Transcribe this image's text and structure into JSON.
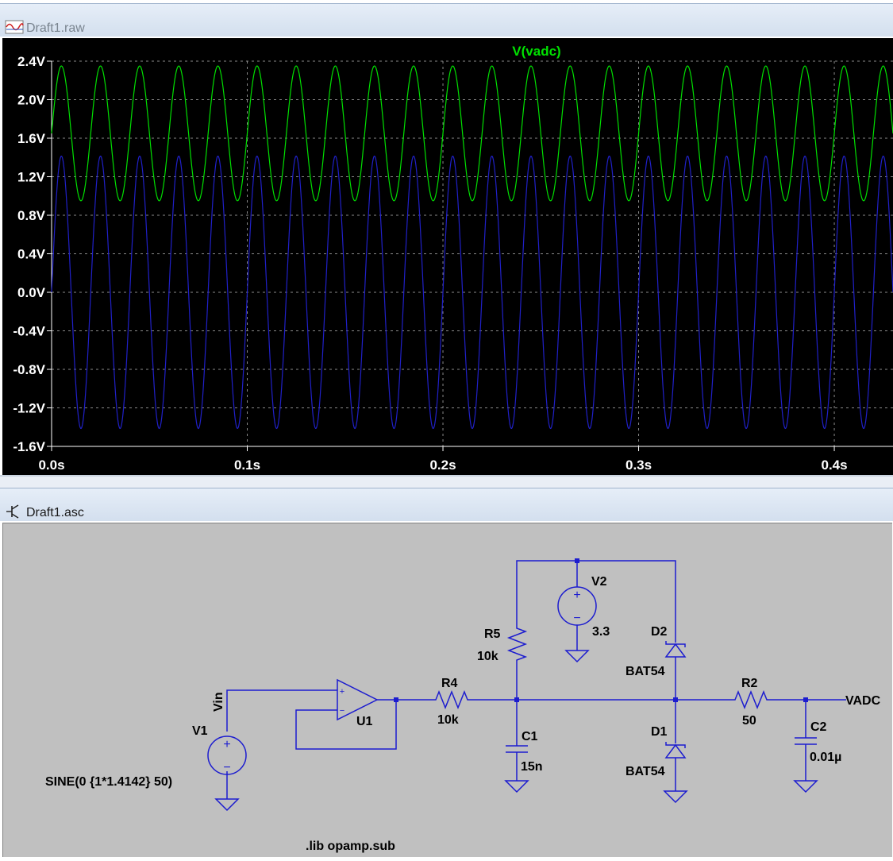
{
  "waveform_window": {
    "title": "Draft1.raw",
    "trace_label": "V(vadc)",
    "y_ticks": [
      "2.4V",
      "2.0V",
      "1.6V",
      "1.2V",
      "0.8V",
      "0.4V",
      "0.0V",
      "-0.4V",
      "-0.8V",
      "-1.2V",
      "-1.6V"
    ],
    "x_ticks": [
      "0.0s",
      "0.1s",
      "0.2s",
      "0.3s",
      "0.4s"
    ],
    "colors": {
      "background": "#000000",
      "trace_vadc": "#00e000",
      "trace_other": "#2020c8",
      "grid": "#8a8a8a",
      "label": "#ffffff"
    }
  },
  "chart_data": {
    "type": "line",
    "title": "V(vadc)",
    "xlabel": "",
    "ylabel": "",
    "xlim": [
      0,
      0.43
    ],
    "ylim": [
      -1.6,
      2.4
    ],
    "x_ticks": [
      0,
      0.1,
      0.2,
      0.3,
      0.4
    ],
    "y_ticks": [
      2.4,
      2.0,
      1.6,
      1.2,
      0.8,
      0.4,
      0.0,
      -0.4,
      -0.8,
      -1.2,
      -1.6
    ],
    "grid": true,
    "series": [
      {
        "name": "V(vadc)",
        "color": "#00e000",
        "waveform": "sine",
        "frequency_hz": 50,
        "offset": 1.65,
        "amplitude": 0.7,
        "phase_deg": 0
      },
      {
        "color": "#2020c8",
        "waveform": "sine",
        "frequency_hz": 50,
        "offset": 0,
        "amplitude": 1.4142,
        "phase_deg": 0
      }
    ]
  },
  "schematic_window": {
    "title": "Draft1.asc",
    "labels": {
      "vin": "Vin",
      "v1": "V1",
      "v1_value": "SINE(0 {1*1.4142} 50)",
      "u1": "U1",
      "r4": "R4",
      "r4_value": "10k",
      "r5": "R5",
      "r5_value": "10k",
      "c1": "C1",
      "c1_value": "15n",
      "v2": "V2",
      "v2_value": "3.3",
      "d2": "D2",
      "d2_value": "BAT54",
      "d1": "D1",
      "d1_value": "BAT54",
      "r2": "R2",
      "r2_value": "50",
      "c2": "C2",
      "c2_value": "0.01µ",
      "vadc": "VADC",
      "lib": ".lib opamp.sub",
      "plus": "+",
      "minus": "−"
    },
    "colors": {
      "background": "#c0c0c0",
      "wire": "#1c1ccf",
      "text": "#000000"
    }
  }
}
